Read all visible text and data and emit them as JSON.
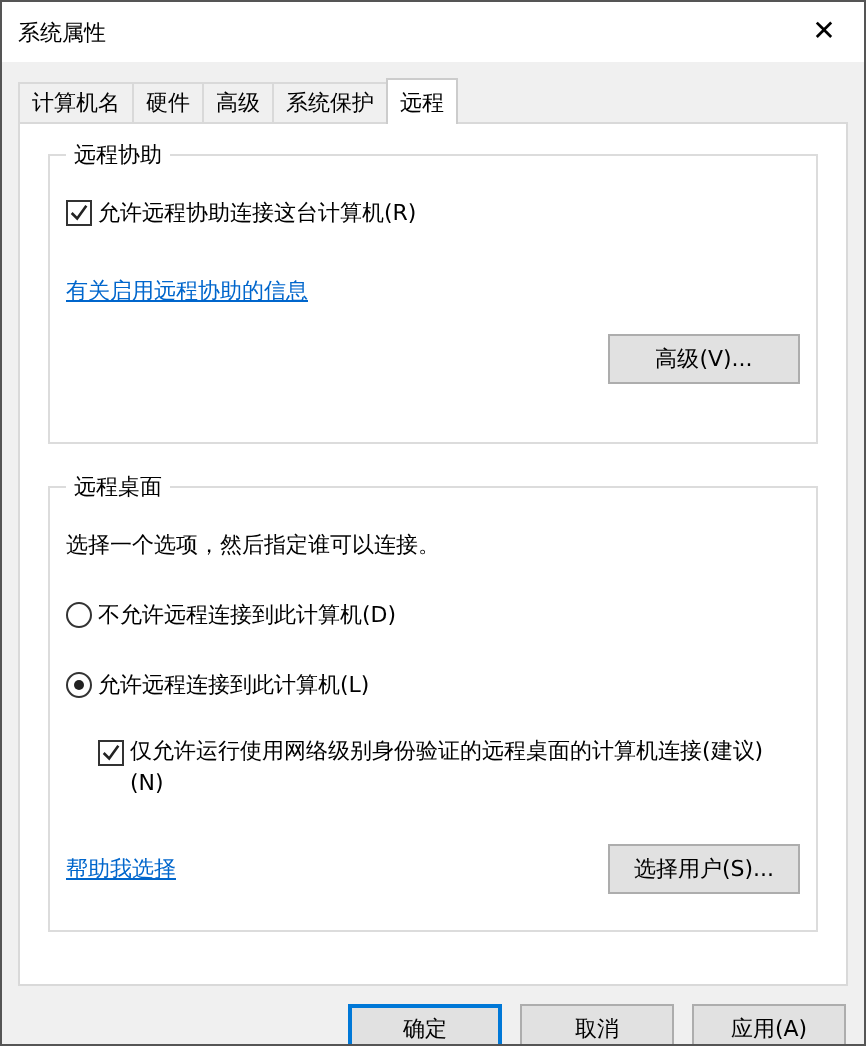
{
  "window": {
    "title": "系统属性",
    "close": "✕"
  },
  "tabs": [
    {
      "label": "计算机名",
      "selected": false
    },
    {
      "label": "硬件",
      "selected": false
    },
    {
      "label": "高级",
      "selected": false
    },
    {
      "label": "系统保护",
      "selected": false
    },
    {
      "label": "远程",
      "selected": true
    }
  ],
  "remote_assistance": {
    "title": "远程协助",
    "checkbox": {
      "label": "允许远程协助连接这台计算机(R)",
      "checked": true
    },
    "link": "有关启用远程协助的信息",
    "button": "高级(V)..."
  },
  "remote_desktop": {
    "title": "远程桌面",
    "instruction": "选择一个选项，然后指定谁可以连接。",
    "options": [
      {
        "label": "不允许远程连接到此计算机(D)",
        "selected": false
      },
      {
        "label": "允许远程连接到此计算机(L)",
        "selected": true
      }
    ],
    "nla_checkbox": {
      "label": "仅允许运行使用网络级别身份验证的远程桌面的计算机连接(建议)(N)",
      "checked": true
    },
    "link": "帮助我选择",
    "button": "选择用户(S)..."
  },
  "buttons": [
    {
      "label": "确定",
      "default": true
    },
    {
      "label": "取消",
      "default": false
    },
    {
      "label": "应用(A)",
      "default": false
    }
  ]
}
